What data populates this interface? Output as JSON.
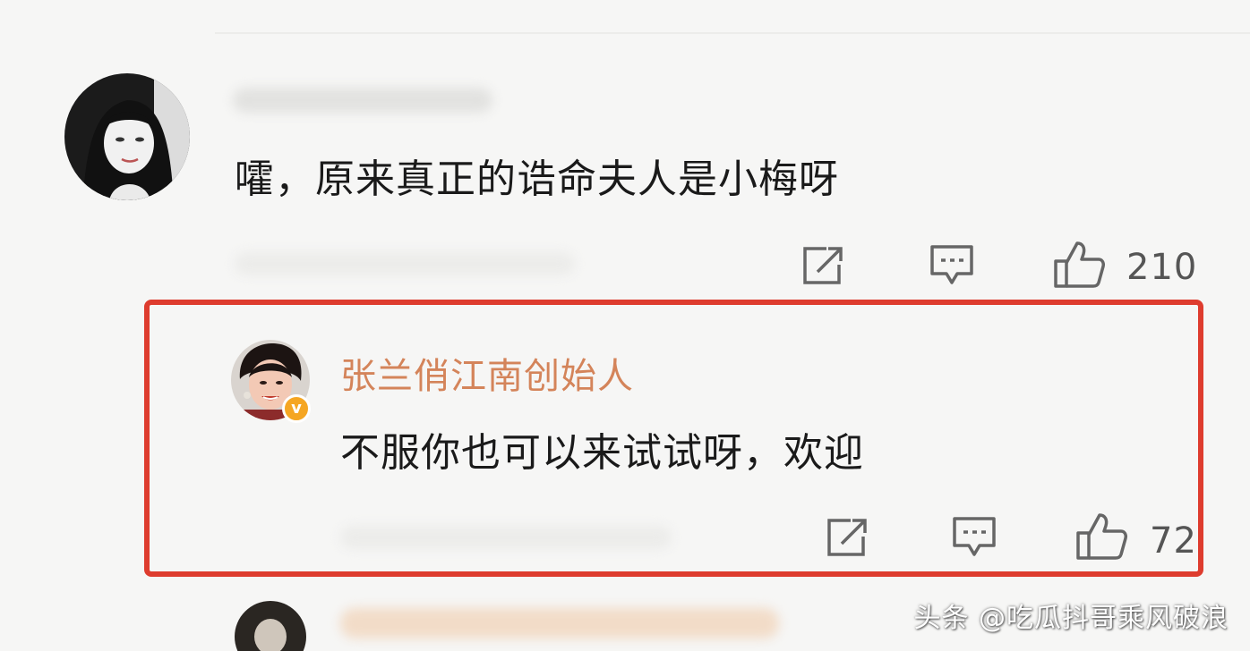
{
  "comment1": {
    "text": "嚯，原来真正的诰命夫人是小梅呀",
    "like_count": "210"
  },
  "reply": {
    "username": "张兰俏江南创始人",
    "text": "不服你也可以来试试呀，欢迎",
    "like_count": "72",
    "verified_badge": "v"
  },
  "watermark": "头条 @吃瓜抖哥乘风破浪",
  "icons": [
    "share-icon",
    "comment-icon",
    "like-icon"
  ],
  "colors": {
    "username": "#d4845a",
    "highlight": "#de3c2e",
    "badge": "#f5a623"
  }
}
